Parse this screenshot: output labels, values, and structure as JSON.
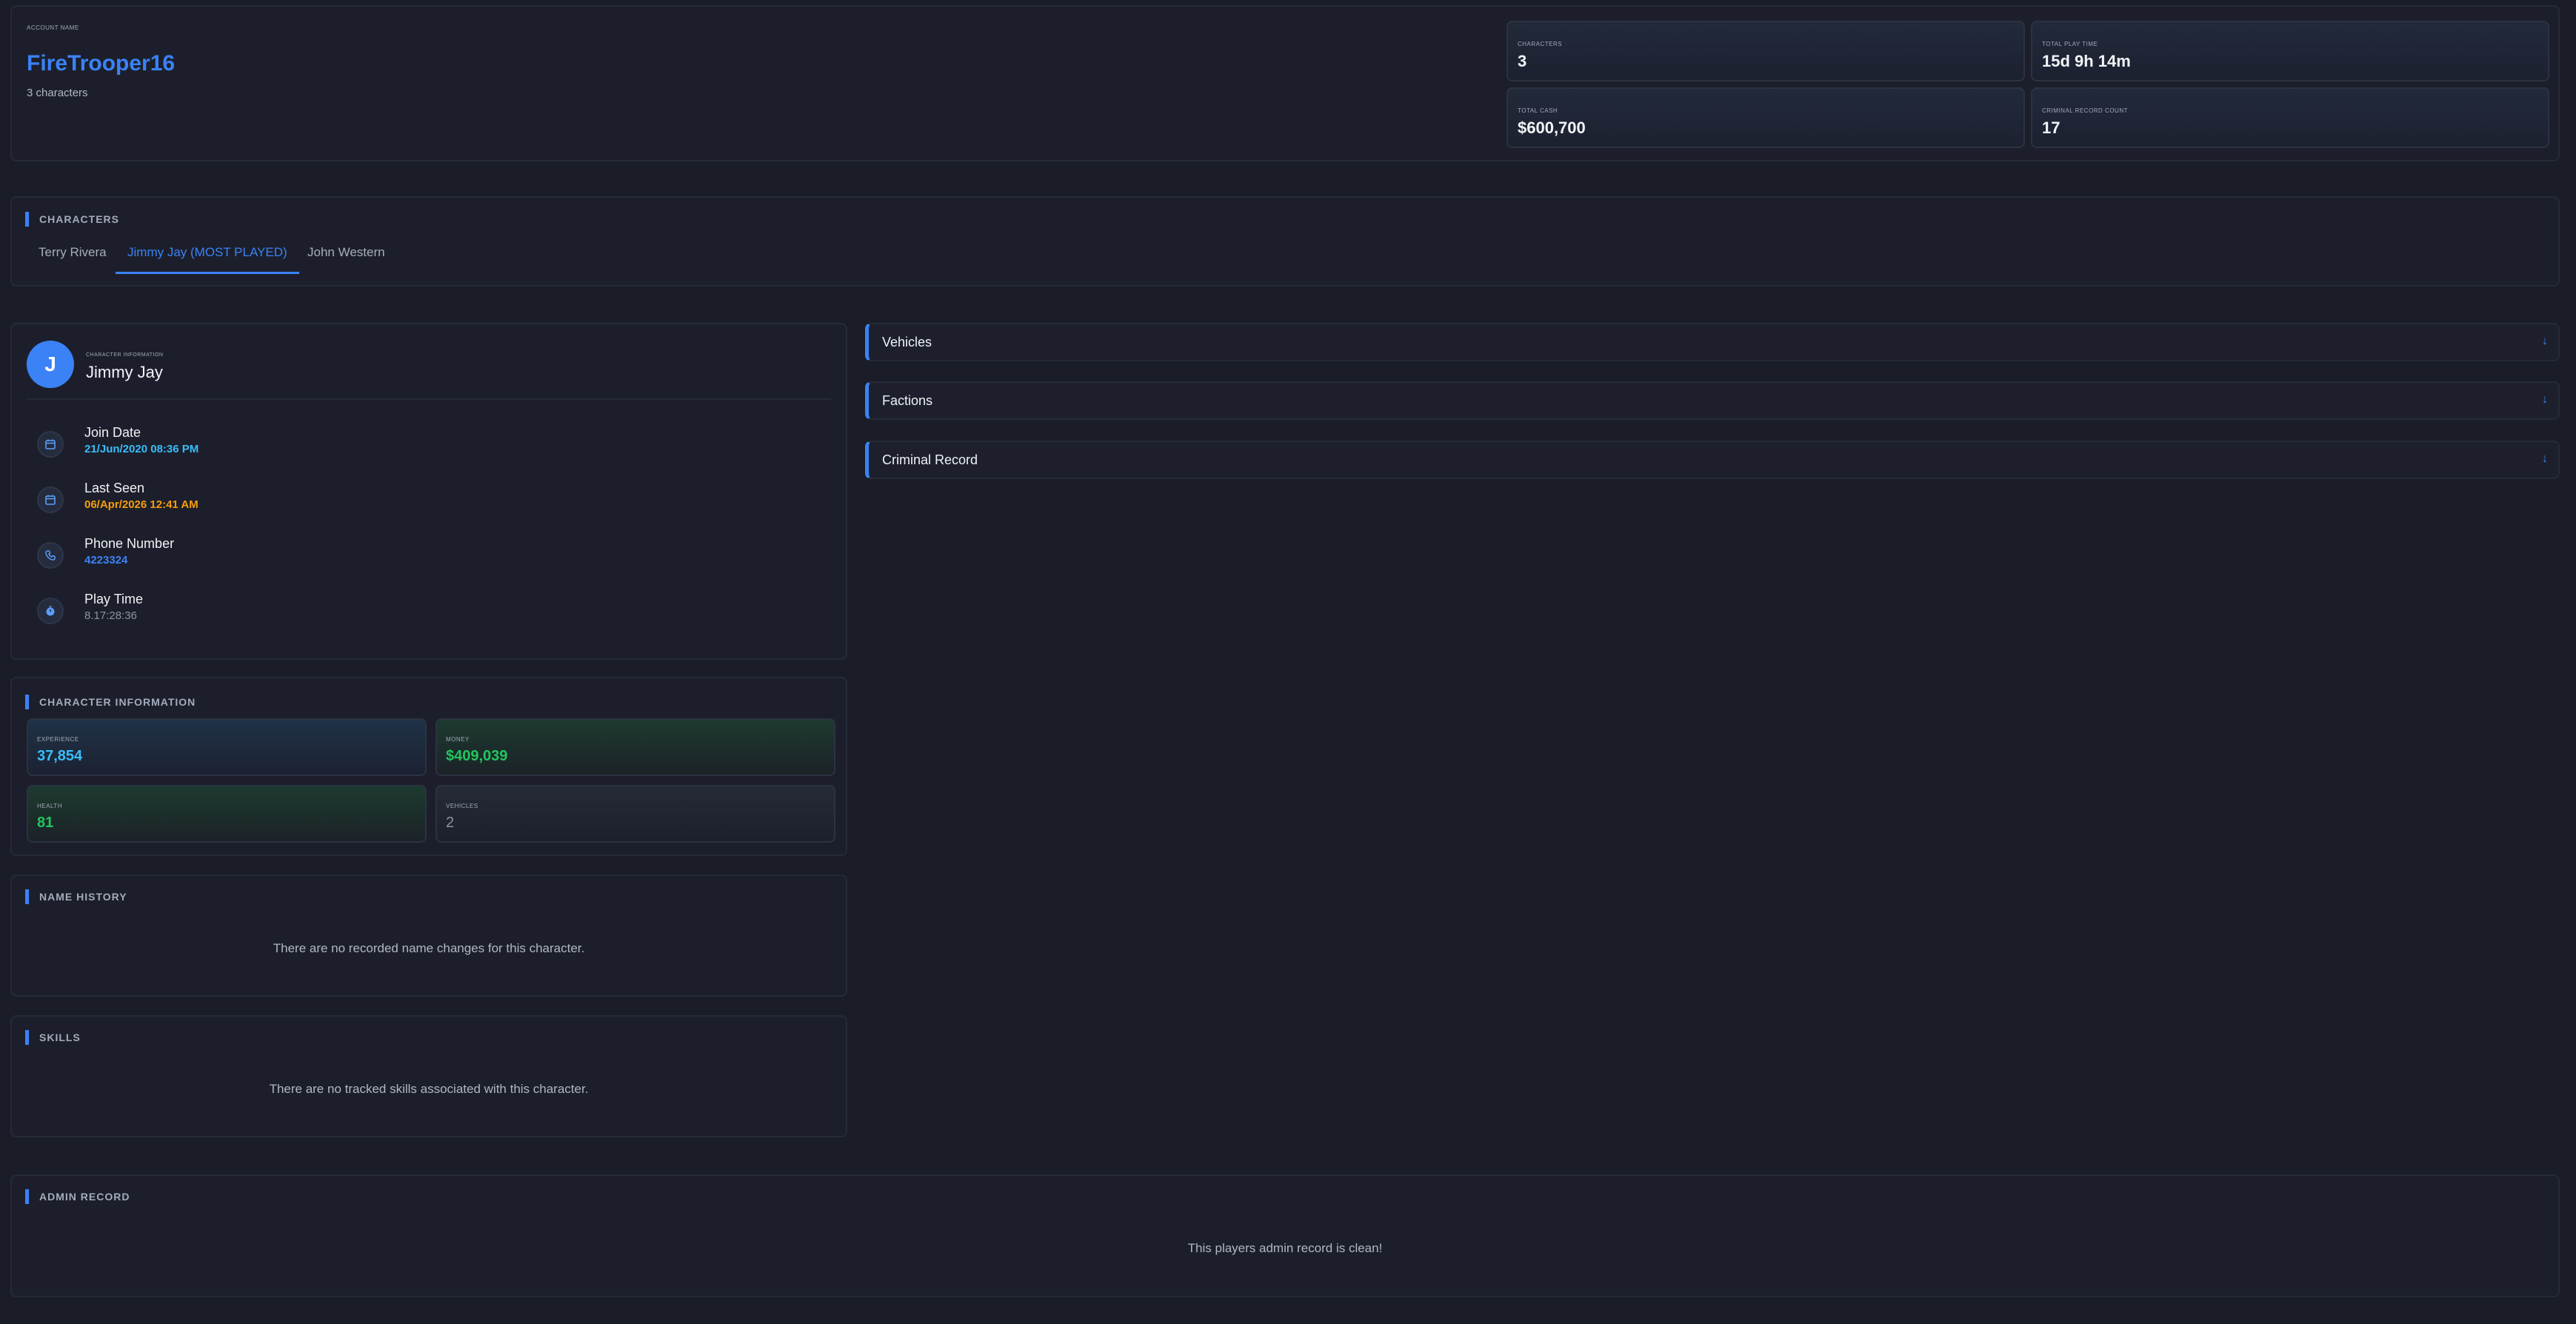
{
  "account": {
    "label": "Account Name",
    "name": "FireTrooper16",
    "subtitle": "3 characters",
    "stats": [
      {
        "label": "Characters",
        "value": "3"
      },
      {
        "label": "Total Play Time",
        "value": "15d 9h 14m"
      },
      {
        "label": "Total Cash",
        "value": "$600,700"
      },
      {
        "label": "Criminal Record Count",
        "value": "17"
      }
    ]
  },
  "characters_section": {
    "title": "Characters",
    "tabs": [
      {
        "label": "Terry Rivera"
      },
      {
        "label": "Jimmy Jay (MOST PLAYED)"
      },
      {
        "label": "John Western"
      }
    ],
    "active_tab": 1
  },
  "profile": {
    "avatar_letter": "J",
    "label": "Character Information",
    "name": "Jimmy Jay",
    "rows": [
      {
        "label": "Join Date",
        "value": "21/Jun/2020 08:36 PM",
        "icon": "calendar-icon",
        "color": "#38bdf8"
      },
      {
        "label": "Last Seen",
        "value": "06/Apr/2026 12:41 AM",
        "icon": "calendar-icon",
        "color": "#f59e0b"
      },
      {
        "label": "Phone Number",
        "value": "4223324",
        "icon": "phone-icon",
        "color": "#3b82f6"
      },
      {
        "label": "Play Time",
        "value": "8.17:28:36",
        "icon": "clock-icon",
        "color": "#8b93a5"
      }
    ]
  },
  "char_info": {
    "title": "Character Information",
    "cards": [
      {
        "label": "Experience",
        "value": "37,854",
        "color": "#38bdf8"
      },
      {
        "label": "Money",
        "value": "$409,039",
        "color": "#22c55e"
      },
      {
        "label": "Health",
        "value": "81",
        "color": "#22c55e"
      },
      {
        "label": "Vehicles",
        "value": "2",
        "color": "#8b93a5"
      }
    ]
  },
  "name_history": {
    "title": "Name History",
    "empty": "There are no recorded name changes for this character."
  },
  "skills": {
    "title": "Skills",
    "empty": "There are no tracked skills associated with this character."
  },
  "accordions": [
    {
      "label": "Vehicles"
    },
    {
      "label": "Factions"
    },
    {
      "label": "Criminal Record"
    }
  ],
  "admin_record": {
    "title": "Admin Record",
    "empty": "This players admin record is clean!"
  },
  "colors": {
    "accent": "#3b82f6",
    "background": "#1a1c27"
  }
}
